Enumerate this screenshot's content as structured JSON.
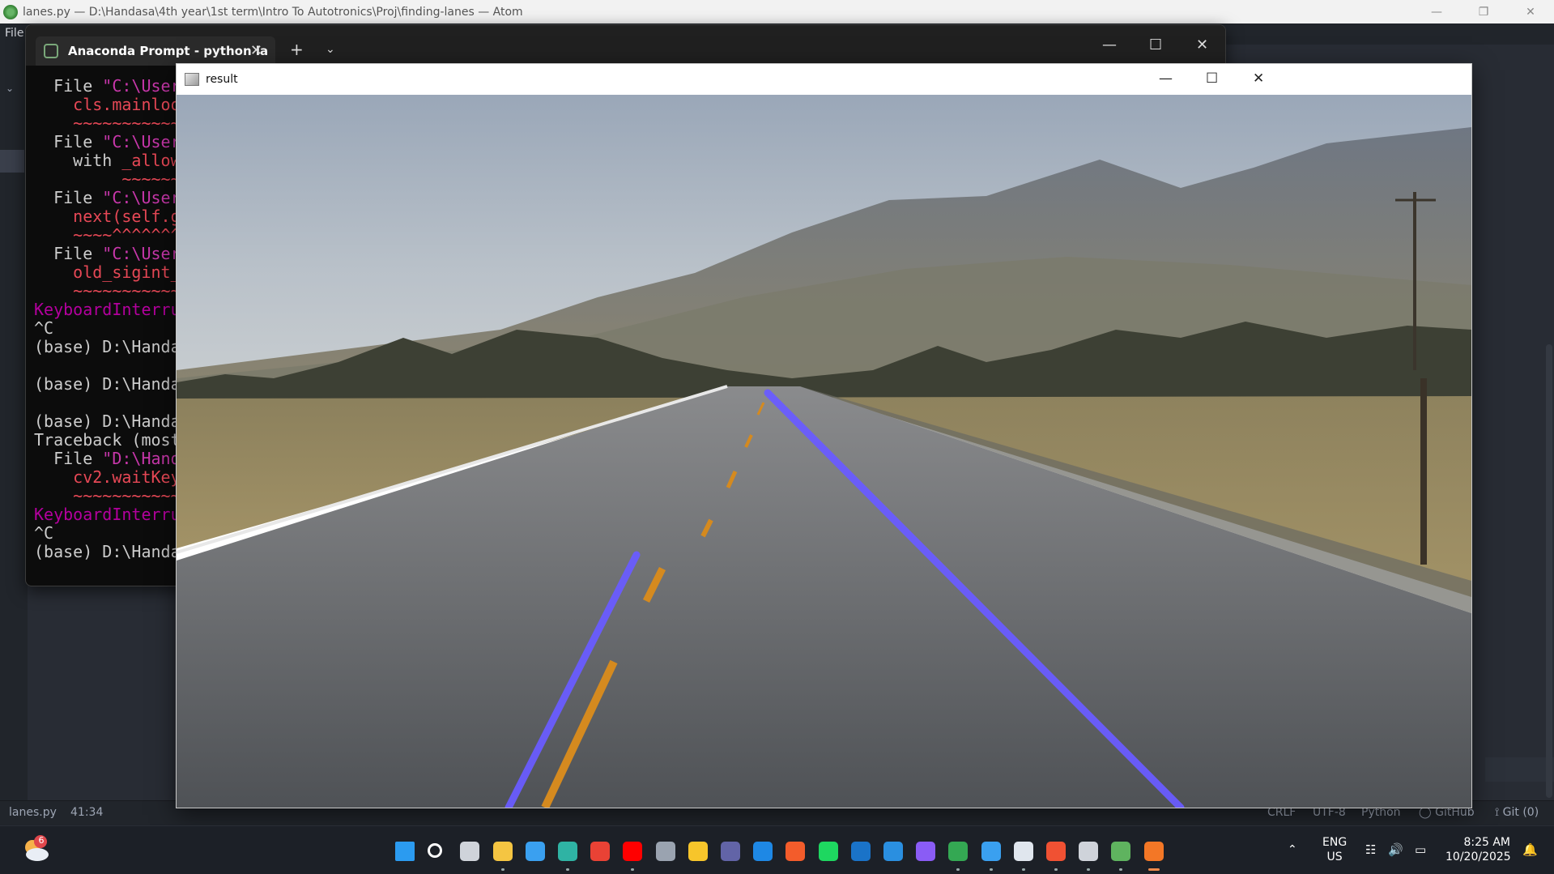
{
  "atom": {
    "title": "lanes.py — D:\\Handasa\\4th year\\1st term\\Intro To Autotronics\\Proj\\finding-lanes — Atom",
    "menu_file": "File",
    "status": {
      "file": "lanes.py",
      "cursor": "41:34",
      "line_ending": "CRLF",
      "encoding": "UTF-8",
      "grammar": "Python",
      "github": "GitHub",
      "git": "Git (0)"
    }
  },
  "terminal": {
    "tab_title": "Anaconda Prompt - python la",
    "lines": [
      {
        "text": "  File ",
        "rest": "\"C:\\User",
        "c": "w",
        "c2": "p"
      },
      {
        "text": "    cls.mainloo",
        "c": "r"
      },
      {
        "text": "    ~~~~~~~~~~~~",
        "c": "r"
      },
      {
        "text": "  File ",
        "rest": "\"C:\\User",
        "c": "w",
        "c2": "p"
      },
      {
        "text": "    with ",
        "rest": "_allow",
        "c": "w",
        "c2": "r"
      },
      {
        "text": "         ~~~~~~",
        "c": "r"
      },
      {
        "text": "  File ",
        "rest": "\"C:\\User",
        "c": "w",
        "c2": "p"
      },
      {
        "text": "    next(self.g",
        "c": "r"
      },
      {
        "text": "    ~~~~^^^^^^^",
        "c": "r"
      },
      {
        "text": "  File ",
        "rest": "\"C:\\User",
        "c": "w",
        "c2": "p"
      },
      {
        "text": "    old_sigint_",
        "c": "r"
      },
      {
        "text": "    ~~~~~~~~~~~~",
        "c": "r"
      },
      {
        "text": "KeyboardInterru",
        "c": "m"
      },
      {
        "text": "^C",
        "c": "w"
      },
      {
        "text": "(base) D:\\Handa",
        "c": "w"
      },
      {
        "text": "",
        "c": "w"
      },
      {
        "text": "(base) D:\\Handa",
        "c": "w"
      },
      {
        "text": "",
        "c": "w"
      },
      {
        "text": "(base) D:\\Handa",
        "c": "w"
      },
      {
        "text": "Traceback (most",
        "c": "w"
      },
      {
        "text": "  File ",
        "rest": "\"D:\\Hand",
        "c": "w",
        "c2": "p"
      },
      {
        "text": "    cv2.waitKey",
        "c": "r"
      },
      {
        "text": "    ~~~~~~~~~~~~",
        "c": "r"
      },
      {
        "text": "KeyboardInterru",
        "c": "m"
      },
      {
        "text": "^C",
        "c": "w"
      },
      {
        "text": "(base) D:\\Handa",
        "c": "w"
      }
    ]
  },
  "result_window": {
    "title": "result"
  },
  "taskbar": {
    "weather_badge": "6",
    "lang_top": "ENG",
    "lang_bottom": "US",
    "time": "8:25 AM",
    "date": "10/20/2025",
    "apps": [
      {
        "icon": "windows-start-icon",
        "color": "#2b9bf0",
        "active": false
      },
      {
        "icon": "search-icon",
        "color": "#ffffff",
        "active": false
      },
      {
        "icon": "task-view-icon",
        "color": "#cfd3da",
        "active": false
      },
      {
        "icon": "file-explorer-icon",
        "color": "#f5c542",
        "active": true
      },
      {
        "icon": "microsoft-store-icon",
        "color": "#3aa0f0",
        "active": false
      },
      {
        "icon": "edge-icon",
        "color": "#2fb3a4",
        "active": true
      },
      {
        "icon": "chrome-icon",
        "color": "#e94235",
        "active": false
      },
      {
        "icon": "youtube-icon",
        "color": "#ff0000",
        "active": true
      },
      {
        "icon": "hexagon-app-icon",
        "color": "#9aa3b0",
        "active": false
      },
      {
        "icon": "google-keep-icon",
        "color": "#f7c52b",
        "active": false
      },
      {
        "icon": "teams-icon",
        "color": "#6264a7",
        "active": false
      },
      {
        "icon": "todo-app-icon",
        "color": "#1e88e5",
        "active": false
      },
      {
        "icon": "brave-icon",
        "color": "#f35c2b",
        "active": false
      },
      {
        "icon": "spotify-icon",
        "color": "#1ed760",
        "active": false
      },
      {
        "icon": "outlook-icon",
        "color": "#1a73c8",
        "active": false
      },
      {
        "icon": "vscode-icon",
        "color": "#2a8fe0",
        "active": false
      },
      {
        "icon": "obsidian-icon",
        "color": "#8a5cf5",
        "active": false
      },
      {
        "icon": "chrome-profile-icon",
        "color": "#34a853",
        "active": true
      },
      {
        "icon": "remote-desktop-icon",
        "color": "#3aa0f0",
        "active": true
      },
      {
        "icon": "whiteboard-icon",
        "color": "#e0e6ee",
        "active": true
      },
      {
        "icon": "git-icon",
        "color": "#f05133",
        "active": true
      },
      {
        "icon": "terminal-icon",
        "color": "#cfd3da",
        "active": true
      },
      {
        "icon": "atom-icon",
        "color": "#5fb35f",
        "active": true
      },
      {
        "icon": "jupyter-icon",
        "color": "#f37726",
        "active": true
      }
    ]
  },
  "colors": {
    "lane_line": "#6a5cff",
    "terminal_bg": "#0c0c0c",
    "atom_bg": "#282c34"
  }
}
